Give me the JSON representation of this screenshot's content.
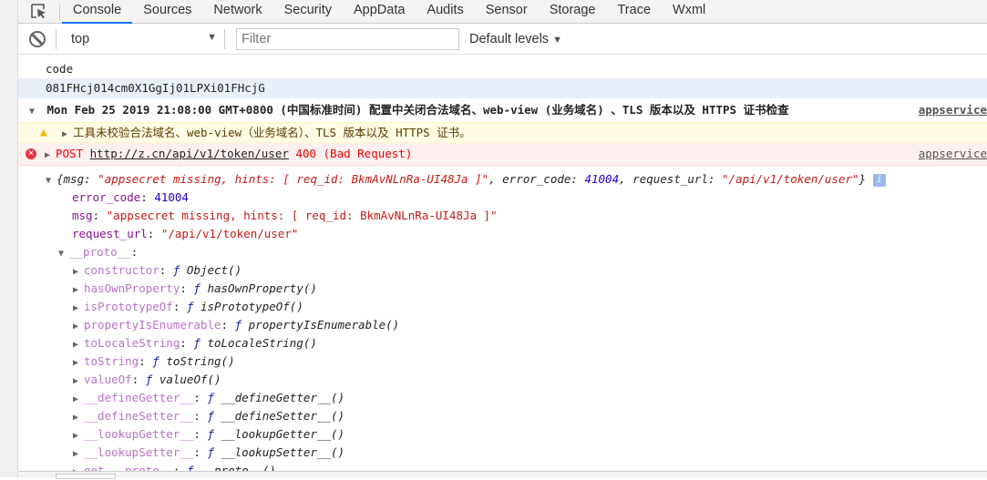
{
  "tabs": [
    "Console",
    "Sources",
    "Network",
    "Security",
    "AppData",
    "Audits",
    "Sensor",
    "Storage",
    "Trace",
    "Wxml"
  ],
  "active_tab": "Console",
  "toolbar": {
    "context": "top",
    "filter_placeholder": "Filter",
    "levels": "Default levels"
  },
  "log": {
    "code_label": "code",
    "code_value": "081FHcj014cm0X1GgIj01LPXi01FHcjG",
    "group_title": "Mon Feb 25 2019 21:08:00 GMT+0800 (中国标准时间) 配置中关闭合法域名、web-view (业务域名) 、TLS 版本以及 HTTPS 证书检查",
    "group_source": "appservice",
    "warning": "工具未校验合法域名、web-view（业务域名）、TLS 版本以及 HTTPS 证书。",
    "error": {
      "method": "POST",
      "url": "http://z.cn/api/v1/token/user",
      "status": "400 (Bad Request)",
      "source": "appservice"
    },
    "object_preview": {
      "open": "{msg: ",
      "msg": "\"appsecret missing, hints: [ req_id: BkmAvNLnRa-UI48Ja ]\"",
      "k2": ", error_code: ",
      "code": "41004",
      "k3": ", request_url: ",
      "url": "\"/api/v1/token/user\"",
      "close": "}"
    },
    "props": [
      {
        "key": "error_code",
        "value": "41004",
        "type": "num"
      },
      {
        "key": "msg",
        "value": "\"appsecret missing, hints: [ req_id: BkmAvNLnRa-UI48Ja ]\"",
        "type": "str"
      },
      {
        "key": "request_url",
        "value": "\"/api/v1/token/user\"",
        "type": "str"
      }
    ],
    "proto_key": "__proto__",
    "proto_items": [
      {
        "key": "constructor",
        "fn": "Object()"
      },
      {
        "key": "hasOwnProperty",
        "fn": "hasOwnProperty()"
      },
      {
        "key": "isPrototypeOf",
        "fn": "isPrototypeOf()"
      },
      {
        "key": "propertyIsEnumerable",
        "fn": "propertyIsEnumerable()"
      },
      {
        "key": "toLocaleString",
        "fn": "toLocaleString()"
      },
      {
        "key": "toString",
        "fn": "toString()"
      },
      {
        "key": "valueOf",
        "fn": "valueOf()"
      },
      {
        "key": "__defineGetter__",
        "fn": "__defineGetter__()"
      },
      {
        "key": "__defineSetter__",
        "fn": "__defineSetter__()"
      },
      {
        "key": "__lookupGetter__",
        "fn": "__lookupGetter__()"
      },
      {
        "key": "__lookupSetter__",
        "fn": "__lookupSetter__()"
      },
      {
        "key": "get __proto__",
        "fn": "__proto__()"
      }
    ]
  }
}
